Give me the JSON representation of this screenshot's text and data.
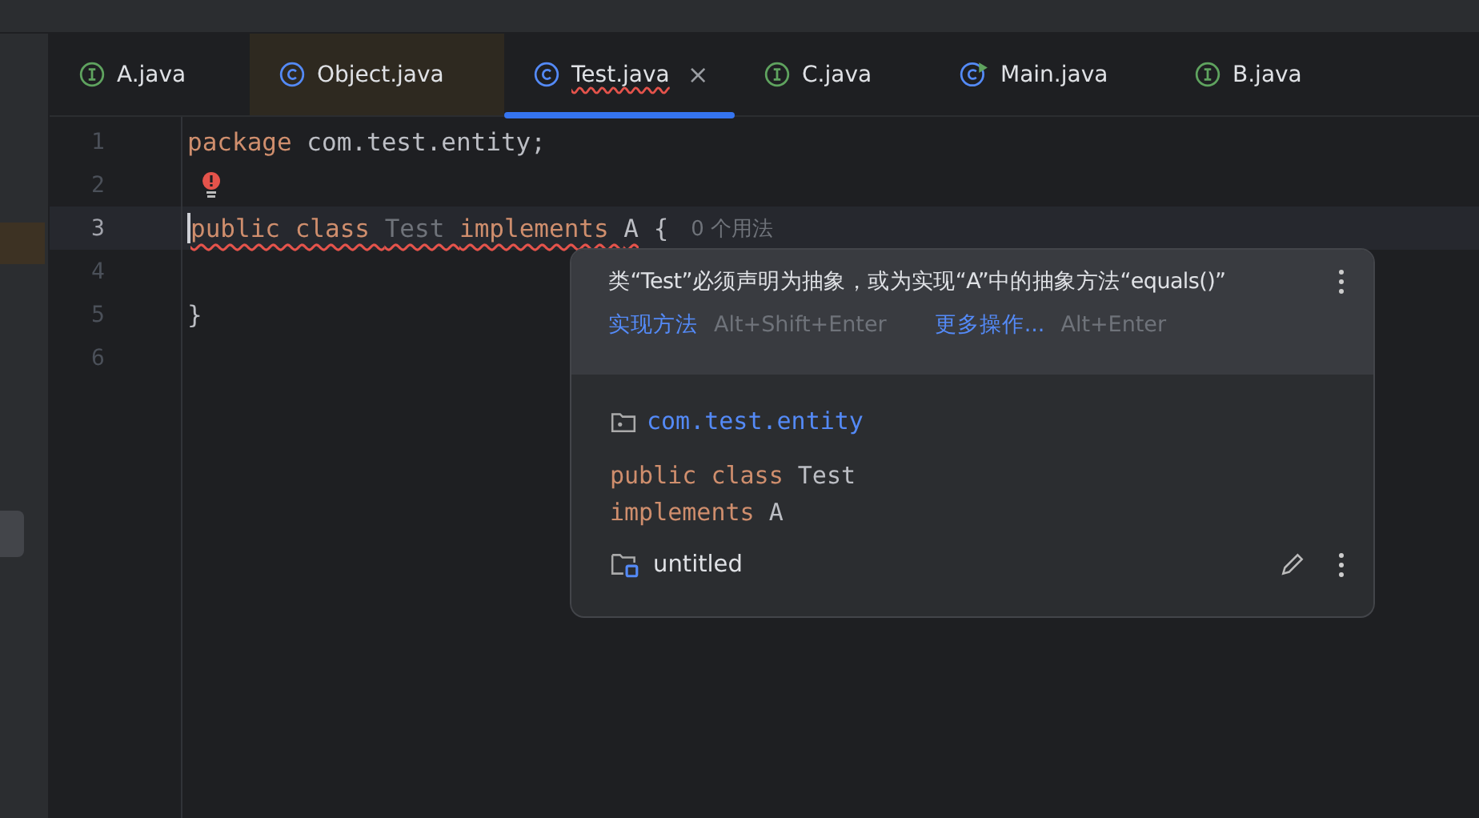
{
  "tabs": [
    {
      "label": "A.java",
      "kind": "interface",
      "selected": false,
      "highlighted": false,
      "error": false
    },
    {
      "label": "Object.java",
      "kind": "class",
      "selected": false,
      "highlighted": true,
      "error": false
    },
    {
      "label": "Test.java",
      "kind": "class",
      "selected": true,
      "highlighted": false,
      "error": true,
      "close": "×"
    },
    {
      "label": "C.java",
      "kind": "interface",
      "selected": false,
      "highlighted": false,
      "error": false
    },
    {
      "label": "Main.java",
      "kind": "main",
      "selected": false,
      "highlighted": false,
      "error": false
    },
    {
      "label": "B.java",
      "kind": "interface",
      "selected": false,
      "highlighted": false,
      "error": false
    }
  ],
  "editor": {
    "lines": [
      {
        "number": "1",
        "current": false,
        "tokens": [
          {
            "text": "package",
            "kind": "keyword",
            "error": false
          },
          {
            "text": " com.test.entity;",
            "kind": "plain",
            "error": false
          }
        ]
      },
      {
        "number": "2",
        "current": false,
        "bulb": true
      },
      {
        "number": "3",
        "current": true,
        "caret": true,
        "tokens": [
          {
            "text": "public class ",
            "kind": "keyword",
            "error": true
          },
          {
            "text": "Test ",
            "kind": "unused",
            "error": true
          },
          {
            "text": "implements ",
            "kind": "keyword",
            "error": true
          },
          {
            "text": "A",
            "kind": "plain",
            "error": true
          },
          {
            "text": " {",
            "kind": "plain",
            "error": false
          }
        ],
        "hint": "0 个用法"
      },
      {
        "number": "4",
        "current": false
      },
      {
        "number": "5",
        "current": false,
        "tokens": [
          {
            "text": "}",
            "kind": "plain",
            "error": false
          }
        ]
      },
      {
        "number": "6",
        "current": false
      }
    ]
  },
  "popup": {
    "message": "类“Test”必须声明为抽象，或为实现“A”中的抽象方法“equals()”",
    "actions": [
      {
        "label": "实现方法",
        "shortcut": "Alt+Shift+Enter"
      },
      {
        "label": "更多操作...",
        "shortcut": "Alt+Enter"
      }
    ],
    "package": "com.test.entity",
    "declaration": [
      [
        {
          "text": "public class ",
          "kind": "keyword"
        },
        {
          "text": "Test",
          "kind": "plain"
        }
      ],
      [
        {
          "text": "implements ",
          "kind": "keyword"
        },
        {
          "text": "A",
          "kind": "plain"
        }
      ]
    ],
    "module": "untitled"
  }
}
